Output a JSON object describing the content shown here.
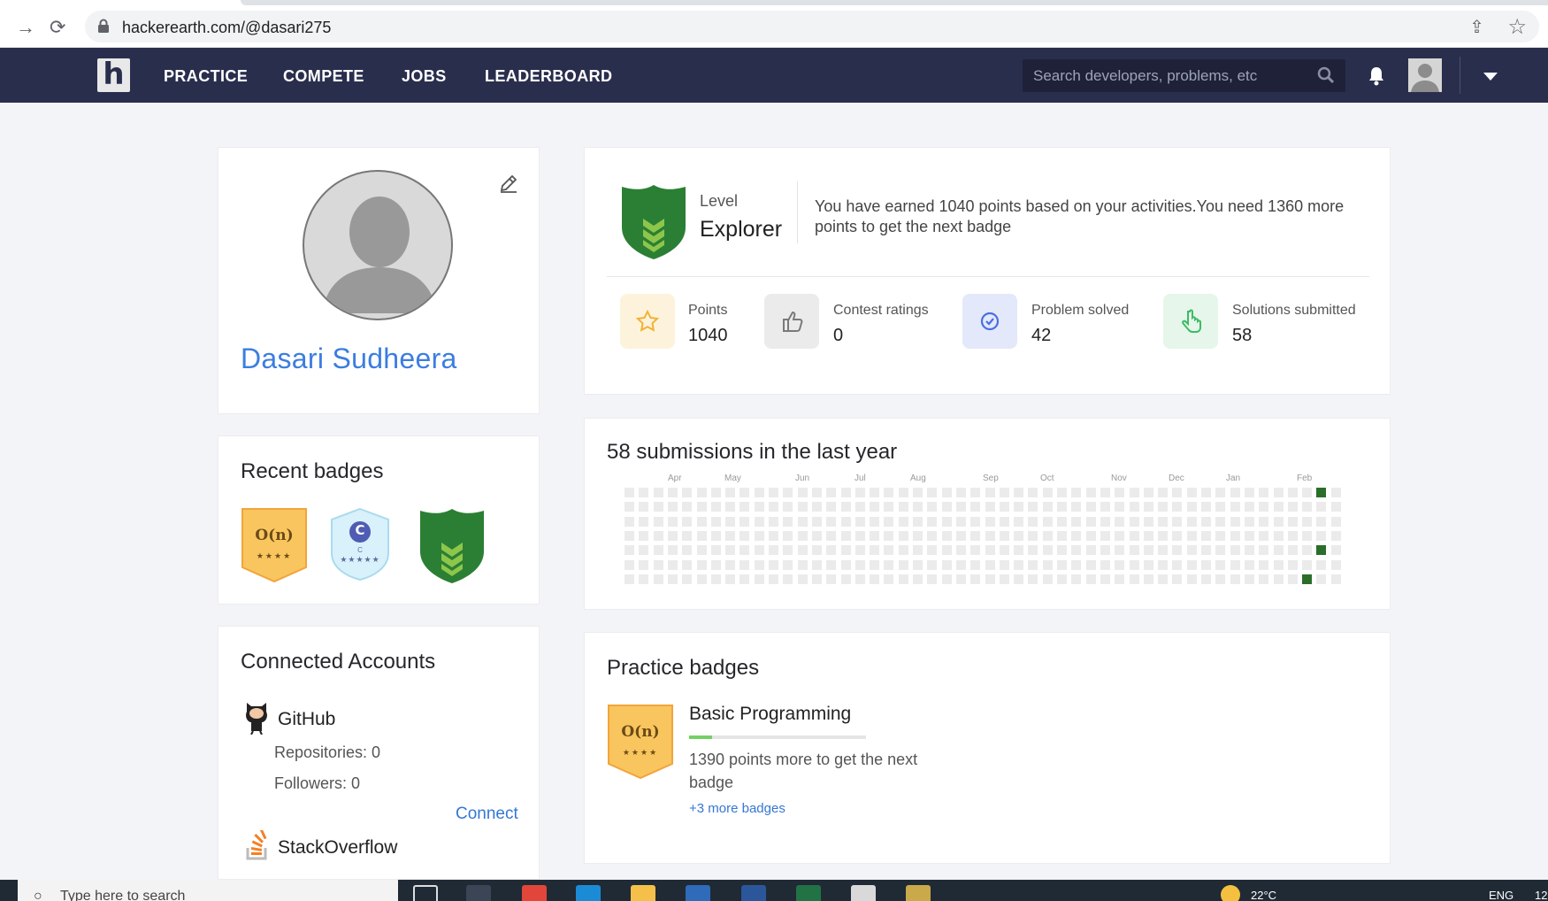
{
  "browser": {
    "url": "hackerearth.com/@dasari275",
    "share_glyph": "⇪",
    "star_glyph": "☆",
    "forward_glyph": "→",
    "reload_glyph": "⟳"
  },
  "navbar": {
    "logo_letter": "h",
    "links": [
      "PRACTICE",
      "COMPETE",
      "JOBS",
      "LEADERBOARD"
    ],
    "search_placeholder": "Search developers, problems, etc",
    "icons": [
      "search-icon",
      "bell-icon",
      "avatar",
      "chevron-down-icon"
    ]
  },
  "profile": {
    "name": "Dasari Sudheera",
    "icons": [
      "edit-icon"
    ]
  },
  "recent_badges": {
    "title": "Recent badges",
    "badges": [
      {
        "kind": "o-n",
        "text": "O(n)",
        "stars": "★★★★",
        "color": "#f8c05c"
      },
      {
        "kind": "c-lang",
        "text": "C",
        "sub": "C",
        "stars": "★★★★★",
        "color": "#d8f0fb"
      },
      {
        "kind": "level-shield",
        "color": "#2b7f34"
      }
    ]
  },
  "connected": {
    "title": "Connected Accounts",
    "github": {
      "name": "GitHub",
      "repos": "Repositories: 0",
      "followers": "Followers: 0",
      "connect": "Connect"
    },
    "stackoverflow": {
      "name": "StackOverflow"
    }
  },
  "level": {
    "label": "Level",
    "value": "Explorer",
    "description": "You have earned 1040 points based on your activities.You need 1360 more points to get the next badge",
    "stats": [
      {
        "label": "Points",
        "value": "1040",
        "icon": "star-icon",
        "bg": "#fdf3dc"
      },
      {
        "label": "Contest ratings",
        "value": "0",
        "icon": "thumbs-up-icon",
        "bg": "#ebebeb"
      },
      {
        "label": "Problem solved",
        "value": "42",
        "icon": "check-circle-icon",
        "bg": "#e3e8fb"
      },
      {
        "label": "Solutions submitted",
        "value": "58",
        "icon": "pointer-hand-icon",
        "bg": "#e6f6ea"
      }
    ]
  },
  "submissions": {
    "title": "58 submissions in the last year",
    "months": [
      "Apr",
      "May",
      "Jun",
      "Jul",
      "Aug",
      "Sep",
      "Oct",
      "Nov",
      "Dec",
      "Jan",
      "Feb"
    ],
    "active_cells": [
      [
        48,
        0
      ],
      [
        48,
        4
      ],
      [
        47,
        6
      ]
    ]
  },
  "practice_badges": {
    "title": "Practice badges",
    "badge": {
      "text": "O(n)",
      "stars": "★★★★"
    },
    "track": "Basic Programming",
    "progress_fraction": 0.13,
    "desc": "1390 points more to get the next badge",
    "more": "+3 more badges"
  },
  "taskbar": {
    "search_placeholder": "Type here to search",
    "weather": "22°C",
    "lang": "ENG",
    "time_fragment": "12"
  }
}
